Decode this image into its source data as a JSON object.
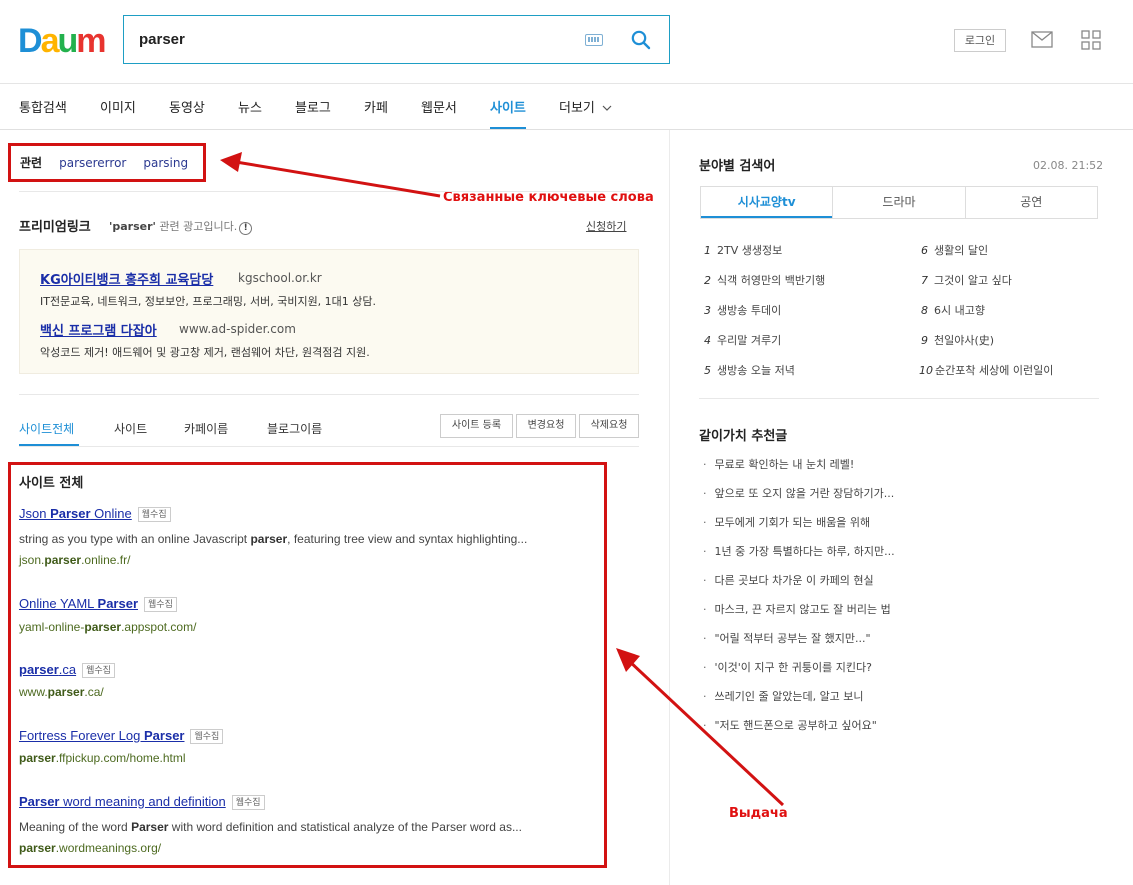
{
  "header": {
    "logo_letters": [
      "D",
      "a",
      "u",
      "m"
    ],
    "logo_colors": [
      "#1e8fd6",
      "#ffb400",
      "#23b14d",
      "#e8342f"
    ],
    "search_value": "parser",
    "login_label": "로그인",
    "icons": {
      "keyboard": "keyboard-icon",
      "search": "search-icon",
      "mail": "mail-icon",
      "apps": "apps-grid-icon"
    }
  },
  "nav": {
    "tabs": [
      "통합검색",
      "이미지",
      "동영상",
      "뉴스",
      "블로그",
      "카페",
      "웹문서",
      "사이트",
      "더보기"
    ],
    "active": "사이트"
  },
  "related": {
    "label": "관련",
    "keywords": [
      "parsererror",
      "parsing"
    ]
  },
  "annotations": {
    "related_note": "Связанные ключевые слова",
    "results_note": "Выдача"
  },
  "premium": {
    "title": "프리미엄링크",
    "sub_query": "'parser'",
    "sub_text": "관련 광고입니다.",
    "apply": "신청하기",
    "ads": [
      {
        "title": "KG아이티뱅크 홍주희 교육담당",
        "url": "kgschool.or.kr",
        "desc": "IT전문교육, 네트워크, 정보보안, 프로그래밍, 서버, 국비지원, 1대1 상담."
      },
      {
        "title": "백신 프로그램 다잡아",
        "url": "www.ad-spider.com",
        "desc": "악성코드 제거! 애드웨어 및 광고창 제거, 랜섬웨어 차단, 원격점검 지원."
      }
    ]
  },
  "subtabs": {
    "tabs": [
      "사이트전체",
      "사이트",
      "카페이름",
      "블로그이름"
    ],
    "active": "사이트전체",
    "buttons": [
      "사이트 등록",
      "변경요청",
      "삭제요청"
    ]
  },
  "results": {
    "heading": "사이트 전체",
    "badge": "웹수집",
    "items": [
      {
        "title_pre": "Json ",
        "title_bold": "Parser",
        "title_post": " Online",
        "desc_pre": "string as you type with an online Javascript ",
        "desc_bold": "parser",
        "desc_post": ", featuring tree view and syntax highlighting...",
        "url_pre": "json.",
        "url_bold": "parser",
        "url_post": ".online.fr/"
      },
      {
        "title_pre": "Online YAML ",
        "title_bold": "Parser",
        "title_post": "",
        "desc_pre": "",
        "desc_bold": "",
        "desc_post": "",
        "url_pre": "yaml-online-",
        "url_bold": "parser",
        "url_post": ".appspot.com/"
      },
      {
        "title_pre": "",
        "title_bold": "parser",
        "title_post": ".ca",
        "desc_pre": "",
        "desc_bold": "",
        "desc_post": "",
        "url_pre": "www.",
        "url_bold": "parser",
        "url_post": ".ca/"
      },
      {
        "title_pre": "Fortress Forever Log ",
        "title_bold": "Parser",
        "title_post": "",
        "desc_pre": "",
        "desc_bold": "",
        "desc_post": "",
        "url_pre": "",
        "url_bold": "parser",
        "url_post": ".ffpickup.com/home.html"
      },
      {
        "title_pre": "",
        "title_bold": "Parser",
        "title_post": " word meaning and definition",
        "desc_pre": "Meaning of the word ",
        "desc_bold": "Parser",
        "desc_post": " with word definition and statistical analyze of the Parser word as...",
        "url_pre": "",
        "url_bold": "parser",
        "url_post": ".wordmeanings.org/"
      }
    ]
  },
  "sidebar": {
    "title": "분야별 검색어",
    "date": "02.08. 21:52",
    "tabs": [
      "시사교양tv",
      "드라마",
      "공연"
    ],
    "ranks": [
      {
        "n": "1",
        "t": "2TV 생생정보"
      },
      {
        "n": "2",
        "t": "식객 허영만의 백반기행"
      },
      {
        "n": "3",
        "t": "생방송 투데이"
      },
      {
        "n": "4",
        "t": "우리말 겨루기"
      },
      {
        "n": "5",
        "t": "생방송 오늘 저녁"
      },
      {
        "n": "6",
        "t": "생활의 달인"
      },
      {
        "n": "7",
        "t": "그것이 알고 싶다"
      },
      {
        "n": "8",
        "t": "6시 내고향"
      },
      {
        "n": "9",
        "t": "천일야사(史)"
      },
      {
        "n": "10",
        "t": "순간포착 세상에 이런일이"
      }
    ],
    "rec_title": "같이가치 추천글",
    "recs": [
      "무료로 확인하는 내 눈치 레벨!",
      "앞으로 또 오지 않을 거란 장담하기가...",
      "모두에게 기회가 되는 배움을 위해",
      "1년 중 가장 특별하다는 하루, 하지만...",
      "다른 곳보다 차가운 이 카페의 현실",
      "마스크, 끈 자르지 않고도 잘 버리는 법",
      "\"어릴 적부터 공부는 잘 했지만...\"",
      "'이것'이 지구 한 귀퉁이를 지킨다?",
      "쓰레기인 줄 알았는데, 알고 보니",
      "\"저도 핸드폰으로 공부하고 싶어요\""
    ]
  }
}
